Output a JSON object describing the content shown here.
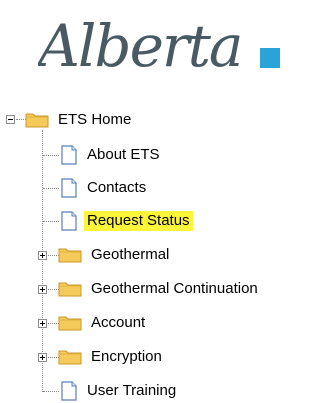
{
  "brand": {
    "logo_text": "Alberta",
    "accent_color": "#2aa4d8"
  },
  "tree": {
    "root": {
      "label": "ETS Home",
      "icon": "folder-icon",
      "expander": "collapse-minus"
    },
    "items": [
      {
        "label": "About ETS",
        "icon": "page-icon",
        "expandable": false,
        "selected": false
      },
      {
        "label": "Contacts",
        "icon": "page-icon",
        "expandable": false,
        "selected": false
      },
      {
        "label": "Request Status",
        "icon": "page-icon",
        "expandable": false,
        "selected": true
      },
      {
        "label": "Geothermal",
        "icon": "folder-icon",
        "expandable": true,
        "selected": false
      },
      {
        "label": "Geothermal Continuation",
        "icon": "folder-icon",
        "expandable": true,
        "selected": false
      },
      {
        "label": "Account",
        "icon": "folder-icon",
        "expandable": true,
        "selected": false
      },
      {
        "label": "Encryption",
        "icon": "folder-icon",
        "expandable": true,
        "selected": false
      },
      {
        "label": "User Training",
        "icon": "page-icon",
        "expandable": false,
        "selected": false
      }
    ],
    "highlight_color": "#fdf53a"
  }
}
